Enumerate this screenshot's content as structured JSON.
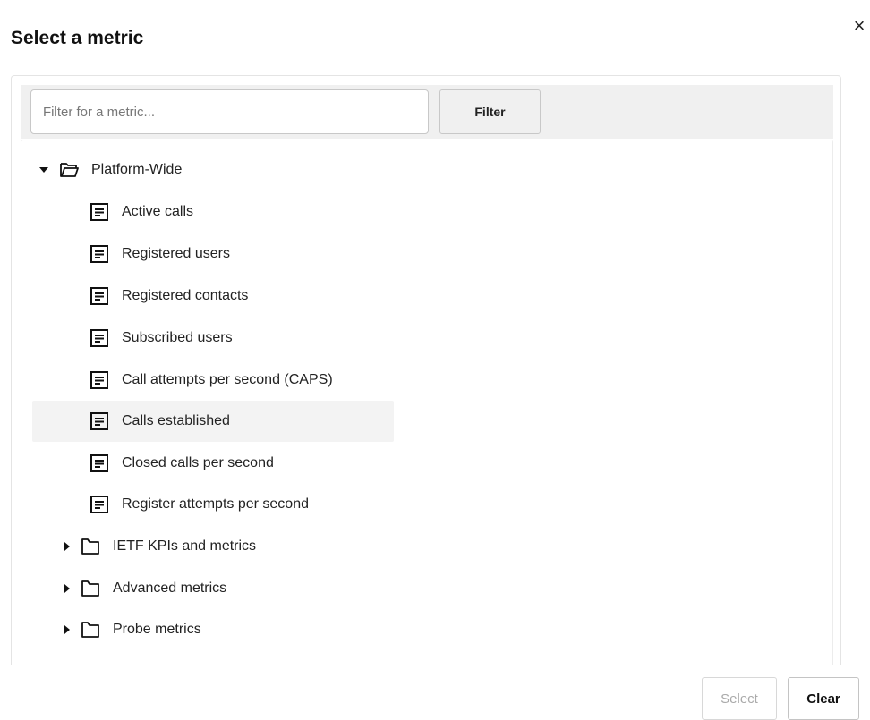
{
  "dialog": {
    "title": "Select a metric",
    "close_label": "×"
  },
  "filter": {
    "placeholder": "Filter for a metric...",
    "value": "",
    "button_label": "Filter"
  },
  "tree": {
    "root": {
      "label": "Platform-Wide",
      "expanded": true,
      "icon": "folder-open-icon"
    },
    "metrics": [
      {
        "label": "Active calls",
        "icon": "document-icon",
        "selected": false
      },
      {
        "label": "Registered users",
        "icon": "document-icon",
        "selected": false
      },
      {
        "label": "Registered contacts",
        "icon": "document-icon",
        "selected": false
      },
      {
        "label": "Subscribed users",
        "icon": "document-icon",
        "selected": false
      },
      {
        "label": "Call attempts per second (CAPS)",
        "icon": "document-icon",
        "selected": false
      },
      {
        "label": "Calls established",
        "icon": "document-icon",
        "selected": true
      },
      {
        "label": "Closed calls per second",
        "icon": "document-icon",
        "selected": false
      },
      {
        "label": "Register attempts per second",
        "icon": "document-icon",
        "selected": false
      }
    ],
    "folders": [
      {
        "label": "IETF KPIs and metrics",
        "expanded": false,
        "icon": "folder-icon"
      },
      {
        "label": "Advanced metrics",
        "expanded": false,
        "icon": "folder-icon"
      },
      {
        "label": "Probe metrics",
        "expanded": false,
        "icon": "folder-icon"
      }
    ]
  },
  "actions": {
    "select_label": "Select",
    "select_disabled": true,
    "clear_label": "Clear"
  },
  "colors": {
    "selected_row_bg": "#f3f3f3",
    "filter_bar_bg": "#f0f0f0",
    "disabled_text": "#aaaaaa"
  }
}
